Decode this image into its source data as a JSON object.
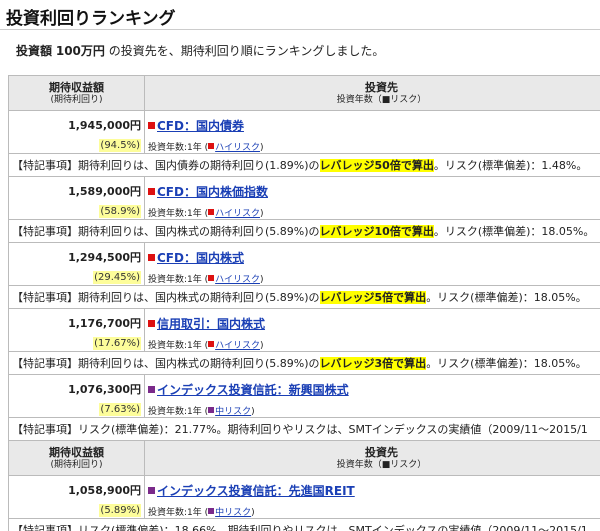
{
  "title": "投資利回りランキング",
  "intro": {
    "label": "投資額",
    "amount": "100万円",
    "text": "の投資先を、期待利回り順にランキングしました。"
  },
  "header": {
    "col1_title": "期待収益額",
    "col1_sub": "(期待利回り)",
    "col2_title": "投資先",
    "col2_sub": "投資年数（■リスク）"
  },
  "colors": {
    "red_square": "#dd1111",
    "purple_square": "#7a2a8a",
    "highlight": "#ffff00",
    "rate_bg": "#fdfd9a",
    "link": "#1a3fb5"
  },
  "rows": [
    {
      "amount": "1,945,000円",
      "rate": "(94.5%)",
      "marker": "red",
      "name": "CFD：国内債券",
      "years": "投資年数:1年",
      "risk": "ハイリスク",
      "note_label": "【特記事項】",
      "note_pre": "期待利回りは、国内債券の期待利回り(1.89%)の",
      "note_hl": "レバレッジ50倍で算出",
      "note_post": "。リスク(標準偏差)：1.48%。"
    },
    {
      "amount": "1,589,000円",
      "rate": "(58.9%)",
      "marker": "red",
      "name": "CFD：国内株価指数",
      "years": "投資年数:1年",
      "risk": "ハイリスク",
      "note_label": "【特記事項】",
      "note_pre": "期待利回りは、国内株式の期待利回り(5.89%)の",
      "note_hl": "レバレッジ10倍で算出",
      "note_post": "。リスク(標準偏差)：18.05%。"
    },
    {
      "amount": "1,294,500円",
      "rate": "(29.45%)",
      "marker": "red",
      "name": "CFD：国内株式",
      "years": "投資年数:1年",
      "risk": "ハイリスク",
      "note_label": "【特記事項】",
      "note_pre": "期待利回りは、国内株式の期待利回り(5.89%)の",
      "note_hl": "レバレッジ5倍で算出",
      "note_post": "。リスク(標準偏差)：18.05%。"
    },
    {
      "amount": "1,176,700円",
      "rate": "(17.67%)",
      "marker": "red",
      "name": "信用取引：国内株式",
      "years": "投資年数:1年",
      "risk": "ハイリスク",
      "note_label": "【特記事項】",
      "note_pre": "期待利回りは、国内株式の期待利回り(5.89%)の",
      "note_hl": "レバレッジ3倍で算出",
      "note_post": "。リスク(標準偏差)：18.05%。"
    },
    {
      "amount": "1,076,300円",
      "rate": "(7.63%)",
      "marker": "purple",
      "name": "インデックス投資信託：新興国株式",
      "years": "投資年数:1年",
      "risk": "中リスク",
      "note_label": "【特記事項】",
      "note_pre": "リスク(標準偏差)：21.77%。期待利回りやリスクは、SMTインデックスの実績値（2009/11～2015/1",
      "note_hl": "",
      "note_post": ""
    },
    {
      "amount": "1,058,900円",
      "rate": "(5.89%)",
      "marker": "purple",
      "name": "インデックス投資信託：先進国REIT",
      "years": "投資年数:1年",
      "risk": "中リスク",
      "note_label": "【特記事項】",
      "note_pre": "リスク(標準偏差)：18.66%。期待利回りやリスクは、SMTインデックスの実績値（2009/11～2015/1",
      "note_hl": "",
      "note_post": ""
    }
  ]
}
